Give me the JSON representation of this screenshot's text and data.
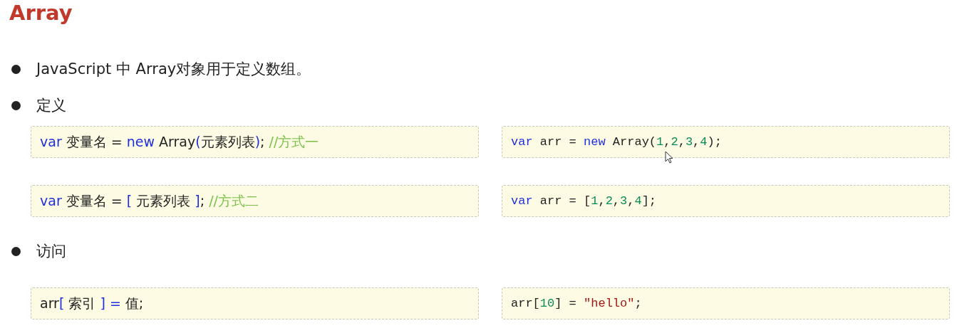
{
  "title": "Array",
  "sections": [
    {
      "bullet": "JavaScript 中 Array对象用于定义数组。"
    },
    {
      "bullet": "定义",
      "rows": [
        {
          "left": [
            {
              "text": "var",
              "kind": "keyword"
            },
            {
              "text": " 变量名 = ",
              "kind": "plain"
            },
            {
              "text": "new",
              "kind": "keyword"
            },
            {
              "text": " Array",
              "kind": "plain"
            },
            {
              "text": "(",
              "kind": "keyword"
            },
            {
              "text": "元素列表",
              "kind": "plain"
            },
            {
              "text": ")",
              "kind": "keyword"
            },
            {
              "text": "; ",
              "kind": "plain"
            },
            {
              "text": "//方式一",
              "kind": "comment"
            }
          ],
          "right": [
            {
              "text": "var",
              "kind": "keyword"
            },
            {
              "text": " arr = ",
              "kind": "plain"
            },
            {
              "text": "new",
              "kind": "keyword"
            },
            {
              "text": " Array(",
              "kind": "plain"
            },
            {
              "text": "1",
              "kind": "number"
            },
            {
              "text": ",",
              "kind": "plain"
            },
            {
              "text": "2",
              "kind": "number"
            },
            {
              "text": ",",
              "kind": "plain"
            },
            {
              "text": "3",
              "kind": "number"
            },
            {
              "text": ",",
              "kind": "plain"
            },
            {
              "text": "4",
              "kind": "number"
            },
            {
              "text": ");",
              "kind": "plain"
            }
          ]
        },
        {
          "left": [
            {
              "text": "var",
              "kind": "keyword"
            },
            {
              "text": " 变量名 = ",
              "kind": "plain"
            },
            {
              "text": "[",
              "kind": "keyword"
            },
            {
              "text": " 元素列表 ",
              "kind": "plain"
            },
            {
              "text": "]",
              "kind": "keyword"
            },
            {
              "text": "; ",
              "kind": "plain"
            },
            {
              "text": "//方式二",
              "kind": "comment"
            }
          ],
          "right": [
            {
              "text": "var",
              "kind": "keyword"
            },
            {
              "text": " arr = [",
              "kind": "plain"
            },
            {
              "text": "1",
              "kind": "number"
            },
            {
              "text": ",",
              "kind": "plain"
            },
            {
              "text": "2",
              "kind": "number"
            },
            {
              "text": ",",
              "kind": "plain"
            },
            {
              "text": "3",
              "kind": "number"
            },
            {
              "text": ",",
              "kind": "plain"
            },
            {
              "text": "4",
              "kind": "number"
            },
            {
              "text": "];",
              "kind": "plain"
            }
          ]
        }
      ]
    },
    {
      "bullet": "访问",
      "rows": [
        {
          "left": [
            {
              "text": "arr",
              "kind": "plain"
            },
            {
              "text": "[",
              "kind": "keyword"
            },
            {
              "text": " 索引 ",
              "kind": "plain"
            },
            {
              "text": "] =",
              "kind": "keyword"
            },
            {
              "text": " 值;",
              "kind": "plain"
            }
          ],
          "right": [
            {
              "text": "arr[",
              "kind": "plain"
            },
            {
              "text": "10",
              "kind": "number"
            },
            {
              "text": "] = ",
              "kind": "plain"
            },
            {
              "text": "\"hello\"",
              "kind": "string"
            },
            {
              "text": ";",
              "kind": "plain"
            }
          ]
        }
      ]
    }
  ]
}
